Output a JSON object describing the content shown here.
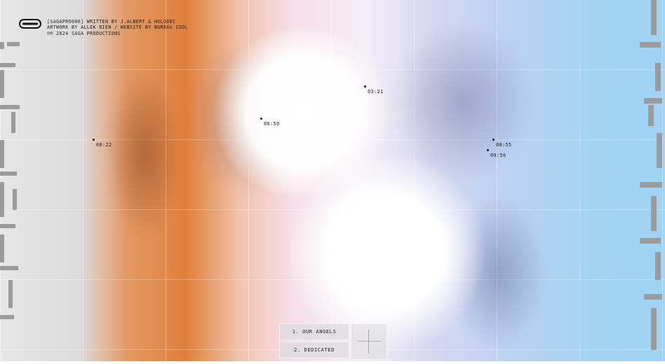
{
  "header": {
    "line1": "[SAGAPRO006] WRITTEN BY J.ALBERT & HOLODEC",
    "line2": "ARTWORK BY ALLEK BIEN / WEBSITE BY BUREAU COOL",
    "line3": "©® 2024 SAGA PRODUCTIONS"
  },
  "markers": [
    "08:22",
    "06:59",
    "03:21",
    "08:55",
    "09:56"
  ],
  "tracks": [
    "1. OUR ANGELS",
    "2. DEDICATED"
  ],
  "colors": {
    "orange": "#e07f3c",
    "blue": "#9fd2f4",
    "grey": "#e6e6e6"
  }
}
